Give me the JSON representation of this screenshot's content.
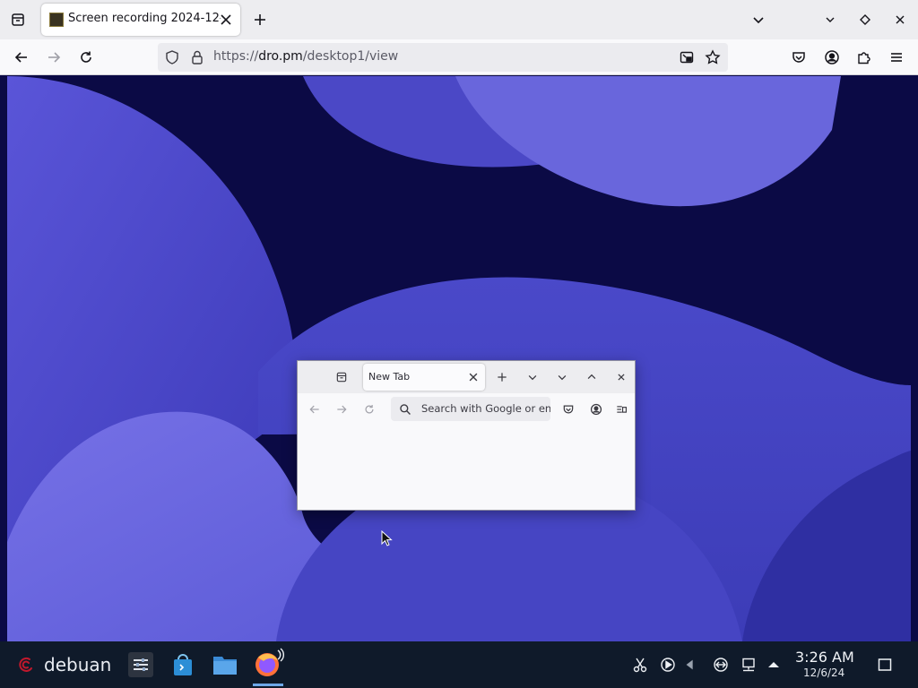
{
  "browser": {
    "tab": {
      "title": "Screen recording 2024-12-"
    },
    "url": {
      "scheme": "https://",
      "host": "dro.pm",
      "path": "/desktop1/view"
    }
  },
  "remote_desktop": {
    "inner_browser": {
      "tab_title": "New Tab",
      "search_placeholder": "Search with Google or ent"
    }
  },
  "taskbar": {
    "start_label": "debuan",
    "clock": {
      "time": "3:26 AM",
      "date": "12/6/24"
    }
  },
  "colors": {
    "accent": "#0060df",
    "desktop_dark": "#0b0a45",
    "wave_light": "#6b69de",
    "taskbar": "#0f1a2a"
  }
}
